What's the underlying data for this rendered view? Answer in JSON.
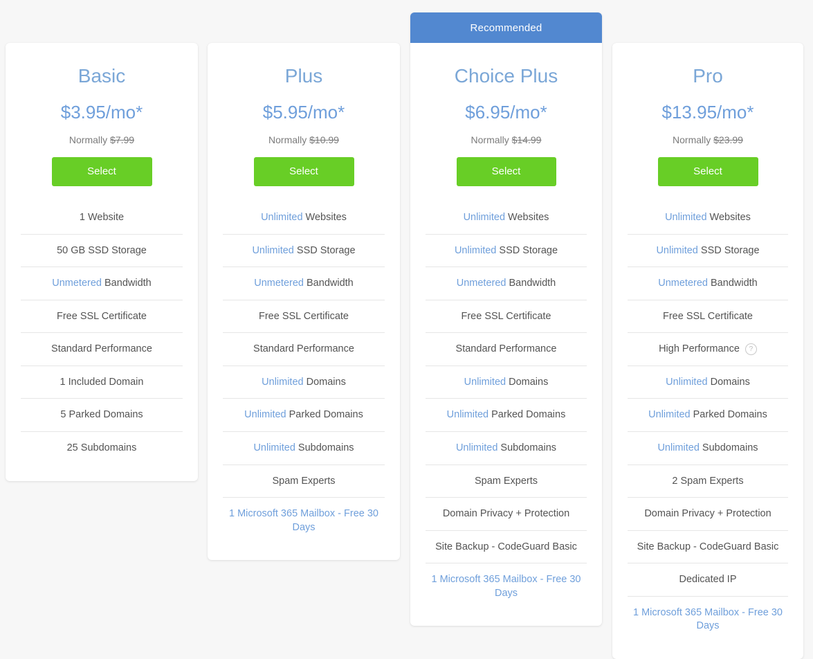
{
  "colors": {
    "page_background": "#f7f7f7",
    "card_background": "#ffffff",
    "accent_blue": "#6f9fdb",
    "ribbon_blue": "#5288d0",
    "button_green": "#68ce26",
    "divider": "#e6e6e6",
    "body_text": "#545454"
  },
  "plans": [
    {
      "id": "basic",
      "name": "Basic",
      "price": "$3.95/mo*",
      "normally_label": "Normally",
      "normally_price": "$7.99",
      "select_label": "Select",
      "ribbon": null,
      "features": [
        {
          "highlight": "",
          "text": "1 Website",
          "link": false
        },
        {
          "highlight": "",
          "text": "50 GB SSD Storage",
          "link": false
        },
        {
          "highlight": "Unmetered",
          "text": " Bandwidth",
          "link": false
        },
        {
          "highlight": "",
          "text": "Free SSL Certificate",
          "link": false
        },
        {
          "highlight": "",
          "text": "Standard Performance",
          "link": false
        },
        {
          "highlight": "",
          "text": "1 Included Domain",
          "link": false
        },
        {
          "highlight": "",
          "text": "5 Parked Domains",
          "link": false
        },
        {
          "highlight": "",
          "text": "25 Subdomains",
          "link": false
        }
      ]
    },
    {
      "id": "plus",
      "name": "Plus",
      "price": "$5.95/mo*",
      "normally_label": "Normally",
      "normally_price": "$10.99",
      "select_label": "Select",
      "ribbon": null,
      "features": [
        {
          "highlight": "Unlimited",
          "text": " Websites",
          "link": false
        },
        {
          "highlight": "Unlimited",
          "text": " SSD Storage",
          "link": false
        },
        {
          "highlight": "Unmetered",
          "text": " Bandwidth",
          "link": false
        },
        {
          "highlight": "",
          "text": "Free SSL Certificate",
          "link": false
        },
        {
          "highlight": "",
          "text": "Standard Performance",
          "link": false
        },
        {
          "highlight": "Unlimited",
          "text": " Domains",
          "link": false
        },
        {
          "highlight": "Unlimited",
          "text": " Parked Domains",
          "link": false
        },
        {
          "highlight": "Unlimited",
          "text": " Subdomains",
          "link": false
        },
        {
          "highlight": "",
          "text": "Spam Experts",
          "link": false
        },
        {
          "highlight": "",
          "text": "1 Microsoft 365 Mailbox - Free 30 Days",
          "link": true
        }
      ]
    },
    {
      "id": "choice-plus",
      "name": "Choice Plus",
      "price": "$6.95/mo*",
      "normally_label": "Normally",
      "normally_price": "$14.99",
      "select_label": "Select",
      "ribbon": "Recommended",
      "features": [
        {
          "highlight": "Unlimited",
          "text": " Websites",
          "link": false
        },
        {
          "highlight": "Unlimited",
          "text": " SSD Storage",
          "link": false
        },
        {
          "highlight": "Unmetered",
          "text": " Bandwidth",
          "link": false
        },
        {
          "highlight": "",
          "text": "Free SSL Certificate",
          "link": false
        },
        {
          "highlight": "",
          "text": "Standard Performance",
          "link": false
        },
        {
          "highlight": "Unlimited",
          "text": " Domains",
          "link": false
        },
        {
          "highlight": "Unlimited",
          "text": " Parked Domains",
          "link": false
        },
        {
          "highlight": "Unlimited",
          "text": " Subdomains",
          "link": false
        },
        {
          "highlight": "",
          "text": "Spam Experts",
          "link": false
        },
        {
          "highlight": "",
          "text": "Domain Privacy + Protection",
          "link": false
        },
        {
          "highlight": "",
          "text": "Site Backup - CodeGuard Basic",
          "link": false
        },
        {
          "highlight": "",
          "text": "1 Microsoft 365 Mailbox - Free 30 Days",
          "link": true
        }
      ]
    },
    {
      "id": "pro",
      "name": "Pro",
      "price": "$13.95/mo*",
      "normally_label": "Normally",
      "normally_price": "$23.99",
      "select_label": "Select",
      "ribbon": null,
      "features": [
        {
          "highlight": "Unlimited",
          "text": " Websites",
          "link": false
        },
        {
          "highlight": "Unlimited",
          "text": " SSD Storage",
          "link": false
        },
        {
          "highlight": "Unmetered",
          "text": " Bandwidth",
          "link": false
        },
        {
          "highlight": "",
          "text": "Free SSL Certificate",
          "link": false
        },
        {
          "highlight": "",
          "text": "High Performance",
          "link": false,
          "help": "?"
        },
        {
          "highlight": "Unlimited",
          "text": " Domains",
          "link": false
        },
        {
          "highlight": "Unlimited",
          "text": " Parked Domains",
          "link": false
        },
        {
          "highlight": "Unlimited",
          "text": " Subdomains",
          "link": false
        },
        {
          "highlight": "",
          "text": "2 Spam Experts",
          "link": false
        },
        {
          "highlight": "",
          "text": "Domain Privacy + Protection",
          "link": false
        },
        {
          "highlight": "",
          "text": "Site Backup - CodeGuard Basic",
          "link": false
        },
        {
          "highlight": "",
          "text": "Dedicated IP",
          "link": false
        },
        {
          "highlight": "",
          "text": "1 Microsoft 365 Mailbox - Free 30 Days",
          "link": true
        }
      ]
    }
  ]
}
